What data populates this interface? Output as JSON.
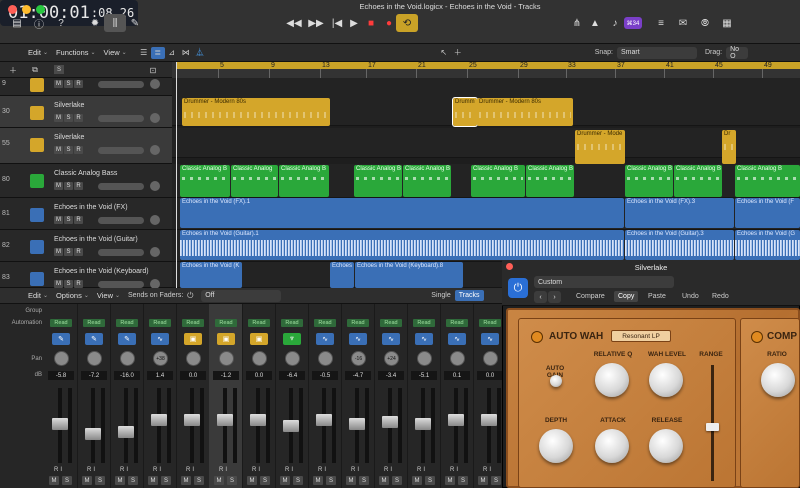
{
  "window": {
    "title": "Echoes in the Void.logicx - Echoes in the Void - Tracks"
  },
  "lcd": {
    "main": "01:00:01",
    "sub": ":08.26"
  },
  "toolbar": {
    "edit": "Edit",
    "functions": "Functions",
    "view": "View",
    "snap_label": "Snap:",
    "snap_value": "Smart",
    "drag_label": "Drag:",
    "drag_value": "No O"
  },
  "header_bar": {
    "count_badge": "⌘34",
    "s_label": "S"
  },
  "ruler": {
    "ticks": [
      "5",
      "9",
      "13",
      "17",
      "21",
      "25",
      "29",
      "33",
      "37",
      "41",
      "45",
      "49"
    ]
  },
  "tracks": [
    {
      "num": "9",
      "name": "",
      "color": "#d4a62a"
    },
    {
      "num": "30",
      "name": "Silverlake",
      "color": "#d4a62a"
    },
    {
      "num": "55",
      "name": "Silverlake",
      "color": "#d4a62a"
    },
    {
      "num": "80",
      "name": "Classic Analog Bass",
      "color": "#2aa83a"
    },
    {
      "num": "81",
      "name": "Echoes in the Void (FX)",
      "color": "#3a6fb6"
    },
    {
      "num": "82",
      "name": "Echoes in the Void (Guitar)",
      "color": "#3a6fb6"
    },
    {
      "num": "83",
      "name": "Echoes in the Void (Keyboard)",
      "color": "#3a6fb6"
    }
  ],
  "ms_labels": {
    "m": "M",
    "s": "S",
    "r": "R",
    "i": "I"
  },
  "regions": {
    "drummer_modern": "Drummer - Modern 80s",
    "drummer_short": "Drumm",
    "drummer_mode": "Drummer - Mode",
    "dr": "Dr",
    "bass": "Classic Analog B",
    "bass2": "Classic Analog",
    "fx1": "Echoes in the Void (FX).1",
    "fx3": "Echoes in the Void (FX).3",
    "fx_short": "Echoes in the Void (F",
    "gtr1": "Echoes in the Void (Guitar).1",
    "gtr3": "Echoes in the Void (Guitar).3",
    "gtr_short": "Echoes in the Void (G",
    "key_k": "Echoes in the Void (K",
    "key_e": "Echoes",
    "key8": "Echoes in the Void (Keyboard).8"
  },
  "mixer": {
    "edit": "Edit",
    "options": "Options",
    "view": "View",
    "sends_label": "Sends on Faders:",
    "sends_value": "Off",
    "single": "Single",
    "tracks": "Tracks",
    "labels": {
      "group": "Group",
      "automation": "Automation",
      "pan": "Pan",
      "db": "dB"
    },
    "read": "Read",
    "strips": [
      {
        "db": "-5.8",
        "pan": "",
        "plug": "pencil"
      },
      {
        "db": "-7.2",
        "pan": "",
        "plug": "pencil"
      },
      {
        "db": "-16.0",
        "pan": "",
        "plug": "pencil"
      },
      {
        "db": "1.4",
        "pan": "+38",
        "plug": "wave"
      },
      {
        "db": "0.0",
        "pan": "",
        "plug": "drum"
      },
      {
        "db": "-1.2",
        "pan": "",
        "plug": "drum"
      },
      {
        "db": "0.0",
        "pan": "",
        "plug": "drum"
      },
      {
        "db": "-6.4",
        "pan": "",
        "plug": "synth"
      },
      {
        "db": "-0.5",
        "pan": "",
        "plug": "wave"
      },
      {
        "db": "-4.7",
        "pan": "-16",
        "plug": "wave"
      },
      {
        "db": "-3.4",
        "pan": "+24",
        "plug": "wave"
      },
      {
        "db": "-5.1",
        "pan": "",
        "plug": "wave"
      },
      {
        "db": "0.1",
        "pan": "",
        "plug": "wave"
      },
      {
        "db": "0.0",
        "pan": "",
        "plug": "wave"
      }
    ]
  },
  "plugin": {
    "title": "Silverlake",
    "preset": "Custom",
    "compare": "Compare",
    "copy": "Copy",
    "paste": "Paste",
    "undo": "Undo",
    "redo": "Redo",
    "autowah": "AUTO WAH",
    "mode": "Resonant LP",
    "comp": "COMP",
    "auto_gain": "AUTO GAIN",
    "relative_q": "RELATIVE Q",
    "wah_level": "WAH LEVEL",
    "range": "RANGE",
    "depth": "DEPTH",
    "attack": "ATTACK",
    "release": "RELEASE",
    "ratio": "RATIO"
  },
  "colors": {
    "accent": "#c9a227",
    "blue": "#3a6fb6",
    "green": "#2aa83a",
    "yellow": "#d4a62a"
  }
}
